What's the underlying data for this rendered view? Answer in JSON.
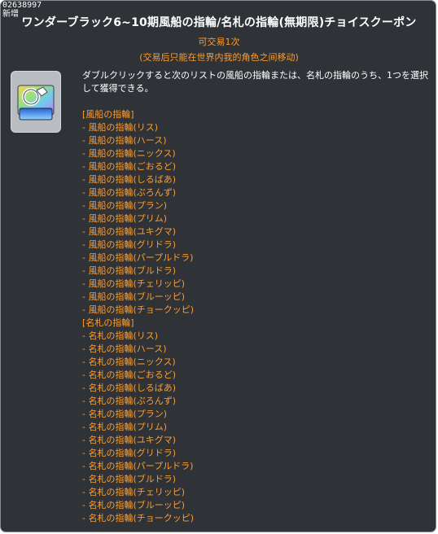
{
  "item_id": "02638997",
  "new_tag": "新增",
  "title": "ワンダーブラック6~10期風船の指輪/名札の指輪(無期限)チョイスクーポン",
  "tradeable": "可交易1次",
  "trade_note": "(交易后只能在世界内我的角色之间移动)",
  "icon": "coupon-ring-icon",
  "description": "ダブルクリックすると次のリストの風船の指輪または、名札の指輪のうち、1つを選択して獲得できる。",
  "sections": [
    {
      "header": "[風船の指輪]",
      "items": [
        "- 風船の指輪(リス)",
        "- 風船の指輪(ハース)",
        "- 風船の指輪(ニックス)",
        "- 風船の指輪(ごおるど)",
        "- 風船の指輪(しるばあ)",
        "- 風船の指輪(ぷろんず)",
        "- 風船の指輪(プラン)",
        "- 風船の指輪(プリム)",
        "- 風船の指輪(ユキグマ)",
        "- 風船の指輪(グリドラ)",
        "- 風船の指輪(パープルドラ)",
        "- 風船の指輪(ブルドラ)",
        "- 風船の指輪(チェリッピ)",
        "- 風船の指輪(ブルーッピ)",
        "- 風船の指輪(チョークッピ)"
      ]
    },
    {
      "header": "[名札の指輪]",
      "items": [
        "- 名札の指輪(リス)",
        "- 名札の指輪(ハース)",
        "- 名札の指輪(ニックス)",
        "- 名札の指輪(ごおるど)",
        "- 名札の指輪(しるばあ)",
        "- 名札の指輪(ぷろんず)",
        "- 名札の指輪(プラン)",
        "- 名札の指輪(プリム)",
        "- 名札の指輪(ユキグマ)",
        "- 名札の指輪(グリドラ)",
        "- 名札の指輪(パープルドラ)",
        "- 名札の指輪(ブルドラ)",
        "- 名札の指輪(チェリッピ)",
        "- 名札の指輪(ブルーッピ)",
        "- 名札の指輪(チョークッピ)"
      ]
    }
  ],
  "colors": {
    "background": "#2f3338",
    "accent_orange": "#ff9c2a",
    "text_white": "#ffffff"
  }
}
